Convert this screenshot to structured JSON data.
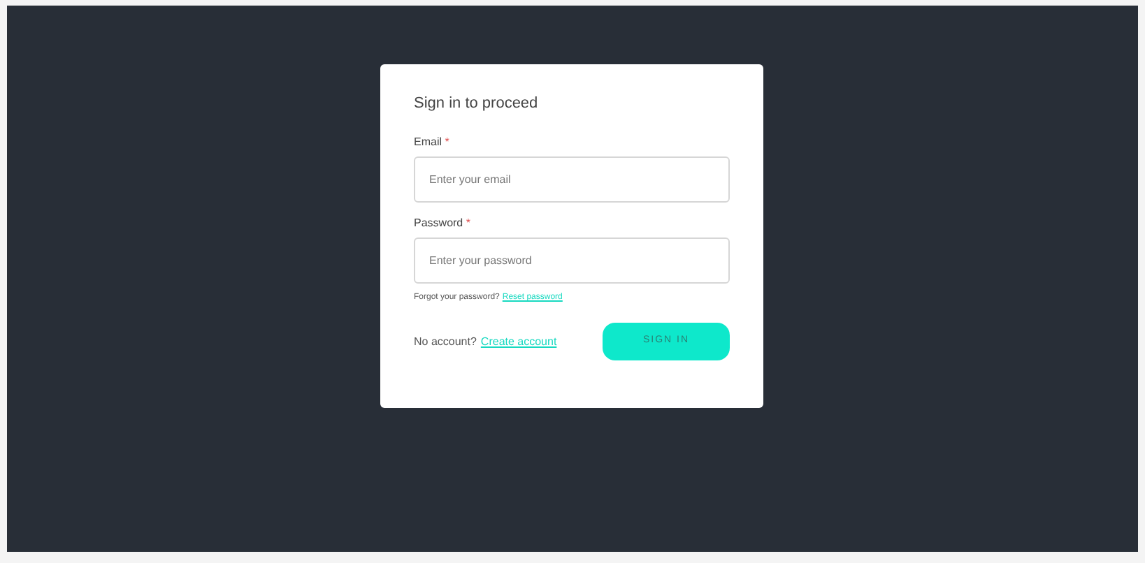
{
  "form": {
    "title": "Sign in to proceed",
    "fields": [
      {
        "label": "Email",
        "required_mark": "*",
        "placeholder": "Enter your email"
      },
      {
        "label": "Password",
        "required_mark": "*",
        "placeholder": "Enter your password"
      }
    ],
    "forgot": {
      "text": "Forgot your password?",
      "link": "Reset password"
    },
    "signup": {
      "text": "No account?",
      "link": "Create account"
    },
    "submit": "SIGN IN"
  }
}
